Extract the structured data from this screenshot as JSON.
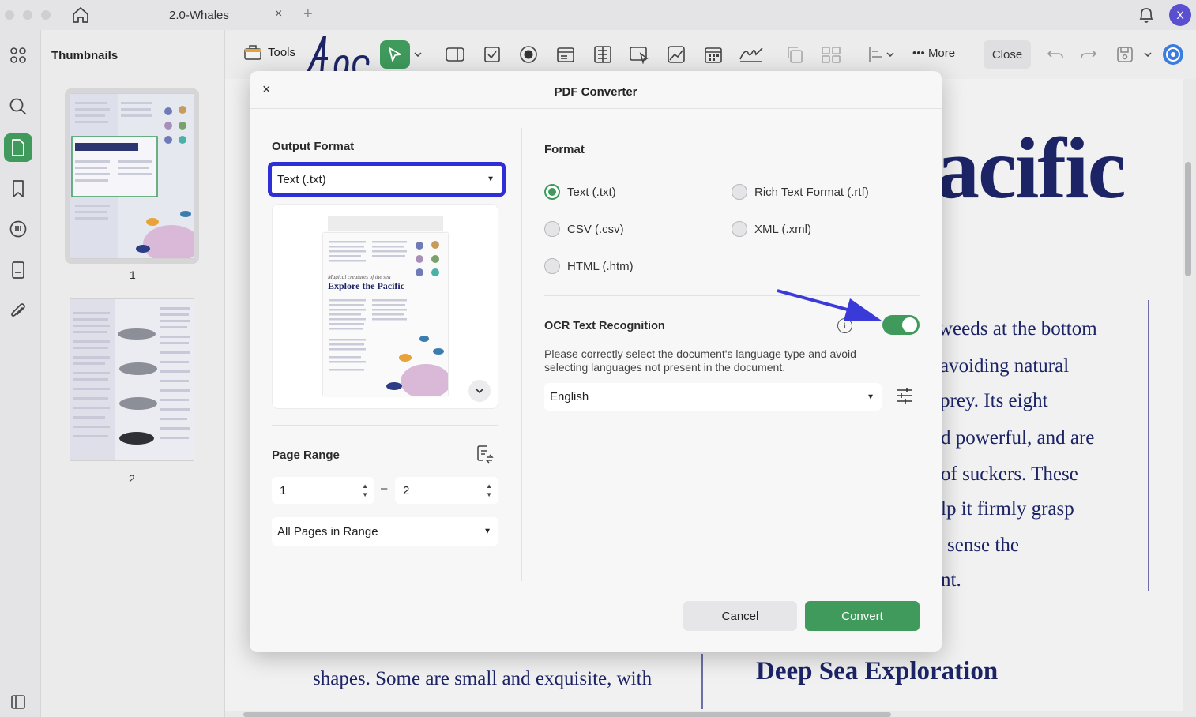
{
  "window": {
    "tab_title": "2.0-Whales",
    "tab_close": "×",
    "tab_add": "+",
    "avatar_initial": "X"
  },
  "thumbnails": {
    "title": "Thumbnails",
    "pages": [
      {
        "number": "1"
      },
      {
        "number": "2"
      }
    ]
  },
  "toolbar": {
    "tools_label": "Tools",
    "more_label": "More",
    "close_label": "Close"
  },
  "document": {
    "big_word": "acific",
    "lines": [
      "weeds at the bottom",
      "avoiding natural",
      "prey. Its eight",
      "d powerful, and are",
      "of suckers. These",
      "lp it firmly grasp",
      "sense the",
      "nt.",
      "shapes. Some are small and exquisite, with"
    ],
    "heading": "Deep Sea Exploration"
  },
  "dialog": {
    "title": "PDF Converter",
    "close_label": "×",
    "output_format": {
      "label": "Output Format",
      "selected": "Text (.txt)",
      "preview_title_small": "Magical creatures of the sea",
      "preview_title": "Explore the Pacific"
    },
    "page_range": {
      "label": "Page Range",
      "from": "1",
      "separator": "–",
      "to": "2",
      "subset": "All Pages in Range"
    },
    "format": {
      "label": "Format",
      "options": [
        {
          "label": "Text (.txt)",
          "checked": true
        },
        {
          "label": "Rich Text Format (.rtf)",
          "checked": false
        },
        {
          "label": "CSV (.csv)",
          "checked": false
        },
        {
          "label": "XML (.xml)",
          "checked": false
        },
        {
          "label": "HTML (.htm)",
          "checked": false
        }
      ]
    },
    "ocr": {
      "label": "OCR Text Recognition",
      "info_glyph": "i",
      "enabled": true,
      "description": "Please correctly select the document's language type and avoid selecting languages not present in the document.",
      "language": "English"
    },
    "buttons": {
      "cancel": "Cancel",
      "convert": "Convert"
    }
  },
  "colors": {
    "accent_green": "#3f9a5c",
    "focus_blue": "#2f2fd8",
    "doc_navy": "#1c2466",
    "arrow_blue": "#3a3ad9"
  },
  "icons": {
    "home": "home-icon",
    "bell": "bell-icon",
    "select": "cursor-arrow-icon",
    "settings": "sliders-icon"
  }
}
